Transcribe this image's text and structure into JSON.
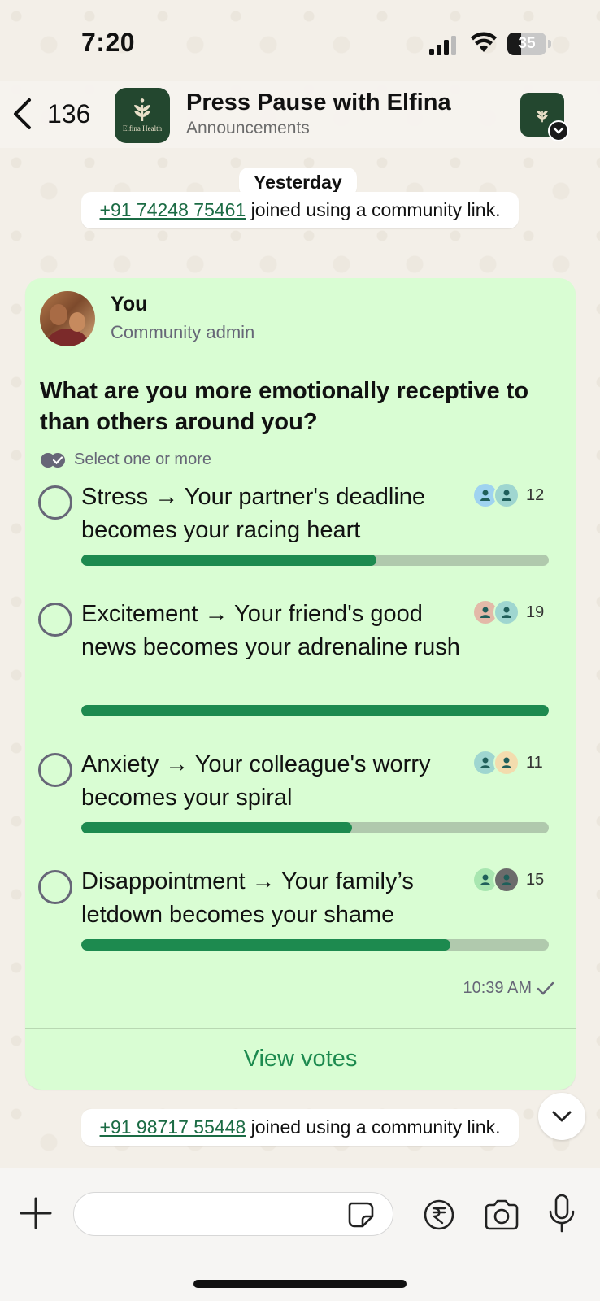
{
  "status_bar": {
    "time": "7:20",
    "battery_level": 35,
    "battery_label": "35"
  },
  "header": {
    "back_count": "136",
    "title": "Press Pause with Elfina",
    "subtitle": "Announcements",
    "avatar_brand": "Elfina Health"
  },
  "date_divider": "Yesterday",
  "system_messages": [
    {
      "phone": "+91 74248 75461",
      "text": " joined using a community link."
    },
    {
      "phone": "+91 98717 55448",
      "text": " joined using a community link."
    }
  ],
  "poll": {
    "sender_name": "You",
    "sender_role": "Community admin",
    "question": "What are you more emotionally receptive to than others around you?",
    "hint": "Select one or more",
    "options": [
      {
        "text": "Stress → Your partner's deadline becomes your racing heart",
        "votes": "12",
        "share": 0.632,
        "voter_colors": [
          "#9fd3f0",
          "#9fd6d0"
        ]
      },
      {
        "text": "Excitement → Your friend's good news becomes your adrenaline rush",
        "votes": "19",
        "share": 1.0,
        "voter_colors": [
          "#e3b9a8",
          "#9fd6d0"
        ]
      },
      {
        "text": "Anxiety → Your colleague's worry becomes your spiral",
        "votes": "11",
        "share": 0.579,
        "voter_colors": [
          "#9fd6d0",
          "#f3dcae"
        ]
      },
      {
        "text": "Disappointment → Your family’s letdown becomes your shame",
        "votes": "15",
        "share": 0.789,
        "voter_colors": [
          "#a8e6b0",
          "#6b6b6b"
        ]
      }
    ],
    "time": "10:39 AM",
    "view_votes": "View votes"
  },
  "input": {
    "placeholder": ""
  },
  "icons": {
    "back": "chevron-left-icon",
    "status_check": "check-icon",
    "scroll": "chevron-down-icon",
    "plus": "plus-icon",
    "sticker": "sticker-icon",
    "rupee": "rupee-icon",
    "camera": "camera-icon",
    "mic": "microphone-icon"
  },
  "colors": {
    "bubble": "#d9fdd3",
    "accent": "#1d8a4f",
    "link": "#1b6b44"
  }
}
